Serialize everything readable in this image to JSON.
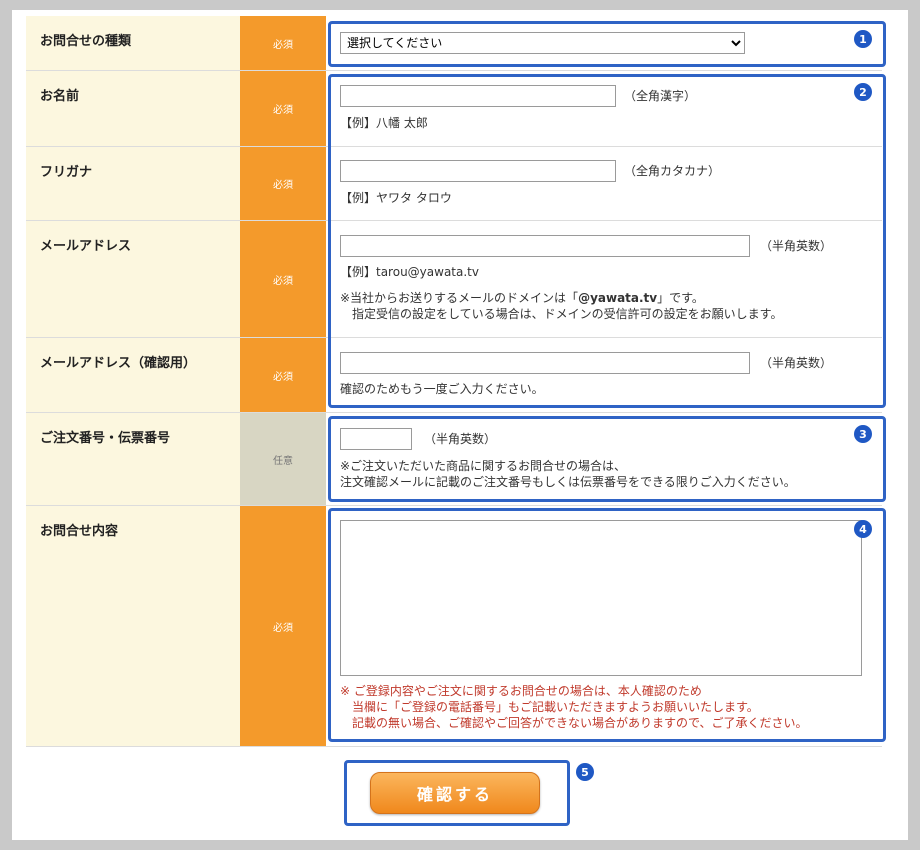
{
  "form": {
    "inquiry_type": {
      "label": "お問合せの種類",
      "required": "必須",
      "selected": "選択してください"
    },
    "name": {
      "label": "お名前",
      "required": "必須",
      "hint": "（全角漢字）",
      "example": "【例】八幡 太郎"
    },
    "furigana": {
      "label": "フリガナ",
      "required": "必須",
      "hint": "（全角カタカナ）",
      "example": "【例】ヤワタ タロウ"
    },
    "email": {
      "label": "メールアドレス",
      "required": "必須",
      "hint": "（半角英数）",
      "example": "【例】tarou@yawata.tv",
      "note1_prefix": "※当社からお送りするメールのドメインは「",
      "note1_domain": "@yawata.tv",
      "note1_suffix": "」です。",
      "note2": "指定受信の設定をしている場合は、ドメインの受信許可の設定をお願いします。"
    },
    "email_confirm": {
      "label": "メールアドレス（確認用）",
      "required": "必須",
      "hint": "（半角英数）",
      "note": "確認のためもう一度ご入力ください。"
    },
    "order_number": {
      "label": "ご注文番号・伝票番号",
      "optional": "任意",
      "hint": "（半角英数）",
      "note1": "※ご注文いただいた商品に関するお問合せの場合は、",
      "note2": "注文確認メールに記載のご注文番号もしくは伝票番号をできる限りご入力ください。"
    },
    "content": {
      "label": "お問合せ内容",
      "required": "必須",
      "note1": "※ ご登録内容やご注文に関するお問合せの場合は、本人確認のため",
      "note2": "当欄に「ご登録の電話番号」もご記載いただきますようお願いいたします。",
      "note3": "記載の無い場合、ご確認やご回答ができない場合がありますので、ご了承ください。"
    }
  },
  "submit_label": "確認する",
  "markers": [
    "1",
    "2",
    "3",
    "4",
    "5"
  ],
  "colors": {
    "required_bg": "#f49a2b",
    "optional_bg": "#d8d6c3",
    "label_bg": "#fcf7df",
    "highlight": "#2f63c5",
    "note_red": "#c0392b"
  }
}
